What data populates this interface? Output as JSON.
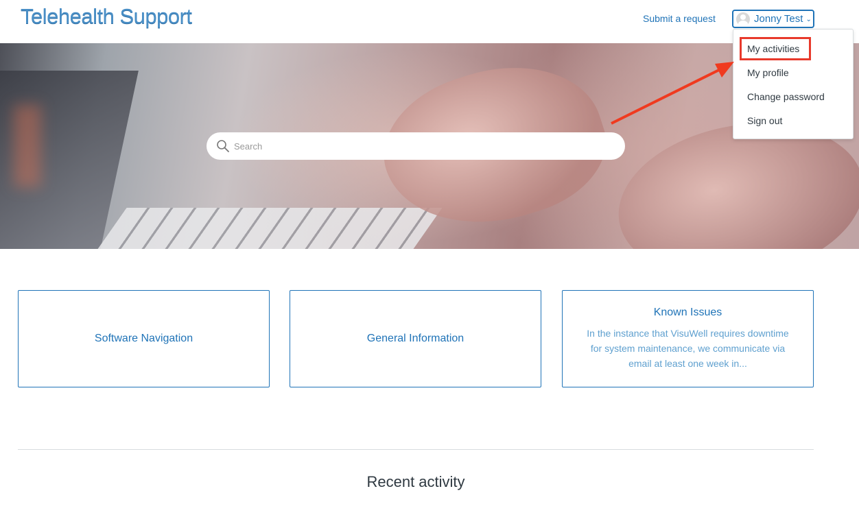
{
  "header": {
    "logo_text": "Telehealth Support",
    "submit_request": "Submit a request",
    "user_name": "Jonny Test"
  },
  "search": {
    "placeholder": "Search"
  },
  "user_menu": {
    "items": [
      "My activities",
      "My profile",
      "Change password",
      "Sign out"
    ],
    "highlighted_item": "My activities"
  },
  "categories": [
    {
      "title": "Software Navigation",
      "description": ""
    },
    {
      "title": "General Information",
      "description": ""
    },
    {
      "title": "Known Issues",
      "description": "In the instance that VisuWell requires downtime for system maintenance, we communicate via email at least one week in..."
    }
  ],
  "recent_activity": {
    "title": "Recent activity"
  },
  "colors": {
    "brand": "#1f73b7",
    "annotation": "#e8392b"
  }
}
